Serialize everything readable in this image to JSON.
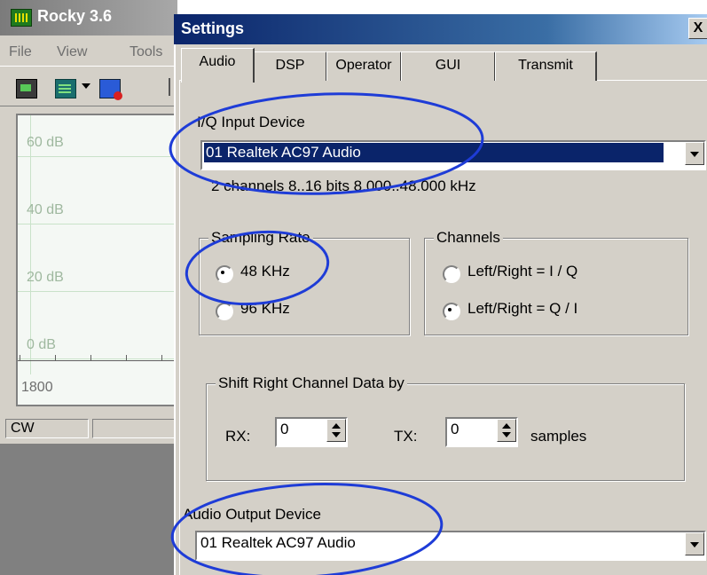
{
  "rocky": {
    "title": "Rocky 3.6",
    "menu": [
      "File",
      "View",
      "Tools"
    ],
    "db_labels": [
      "60 dB",
      "40 dB",
      "20 dB",
      "0 dB"
    ],
    "freq_label": "1800",
    "mode": "CW"
  },
  "settings": {
    "title": "Settings",
    "close_label": "X",
    "tabs": [
      "Audio",
      "DSP",
      "Operator",
      "GUI",
      "Transmit"
    ],
    "iq_input": {
      "label": "I/Q Input Device",
      "value": "01  Realtek AC97 Audio",
      "info": "2 channels  8..16 bits  8.000..48.000 kHz"
    },
    "sampling_rate": {
      "title": "Sampling Rate",
      "options": [
        "48 KHz",
        "96 KHz"
      ],
      "selected": "48 KHz"
    },
    "channels": {
      "title": "Channels",
      "options": [
        "Left/Right = I / Q",
        "Left/Right = Q / I"
      ],
      "selected": "Left/Right = Q / I"
    },
    "shift": {
      "title": "Shift Right Channel Data by",
      "rx_label": "RX:",
      "rx_value": "0",
      "tx_label": "TX:",
      "tx_value": "0",
      "units": "samples"
    },
    "audio_output": {
      "label": "Audio Output Device",
      "value": "01  Realtek AC97 Audio"
    }
  },
  "colors": {
    "annotation": "#1e3cd7",
    "title_bar": "#0a246a"
  }
}
